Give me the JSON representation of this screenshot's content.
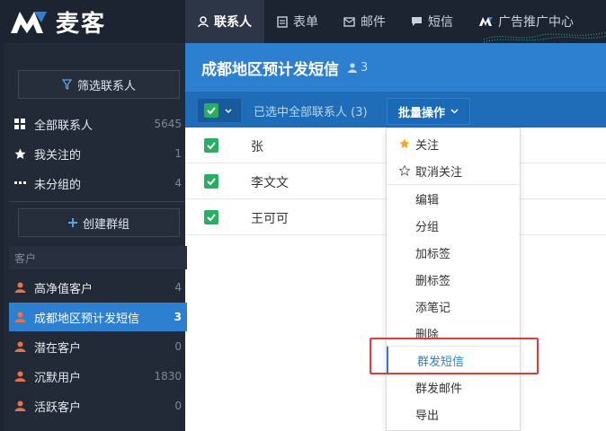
{
  "app": {
    "name": "麦客"
  },
  "nav": [
    {
      "label": "联系人",
      "icon": "user-icon",
      "active": true
    },
    {
      "label": "表单",
      "icon": "form-icon",
      "active": false
    },
    {
      "label": "邮件",
      "icon": "mail-icon",
      "active": false
    },
    {
      "label": "短信",
      "icon": "message-icon",
      "active": false
    },
    {
      "label": "广告推广中心",
      "icon": "brand-icon",
      "active": false
    }
  ],
  "sidebar": {
    "filter_label": "筛选联系人",
    "all": {
      "label": "全部联系人",
      "count": "5645"
    },
    "starred": {
      "label": "我关注的",
      "count": "1"
    },
    "ungrouped": {
      "label": "未分组的",
      "count": "4"
    },
    "create_group_label": "创建群组",
    "section_label": "客户",
    "groups": [
      {
        "label": "高净值客户",
        "count": "4",
        "active": false
      },
      {
        "label": "成都地区预计发短信",
        "count": "3",
        "active": true
      },
      {
        "label": "潜在客户",
        "count": "0",
        "active": false
      },
      {
        "label": "沉默用户",
        "count": "1830",
        "active": false
      },
      {
        "label": "活跃客户",
        "count": "0",
        "active": false
      }
    ]
  },
  "main": {
    "title": "成都地区预计发短信",
    "member_count": "3",
    "selected_text": "已选中全部联系人 (3)",
    "batch_label": "批量操作",
    "contacts": [
      {
        "name": "张"
      },
      {
        "name": "李文文"
      },
      {
        "name": "王可可"
      }
    ]
  },
  "menu": {
    "follow": "关注",
    "unfollow": "取消关注",
    "edit": "编辑",
    "group": "分组",
    "add_tag": "加标签",
    "remove_tag": "删标签",
    "add_note": "添笔记",
    "delete": "删除",
    "send_sms": "群发短信",
    "send_email": "群发邮件",
    "export": "导出"
  },
  "colors": {
    "accent": "#2d7fcf",
    "topbar": "#1c2331",
    "sidebar": "#232a37",
    "check": "#27ae60",
    "highlight_box": "#e53935",
    "star": "#f5a623",
    "group_icon": "#e8734a"
  }
}
